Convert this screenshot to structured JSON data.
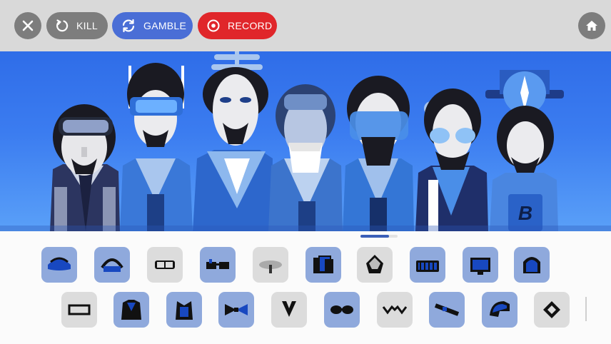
{
  "toolbar": {
    "kill_label": "KILL",
    "gamble_label": "GAMBLE",
    "record_label": "RECORD",
    "close_icon": "close-icon",
    "home_icon": "home-icon"
  },
  "colors": {
    "toolbar_bg": "#d9d9d9",
    "kill": "#7d7d7d",
    "gamble": "#4a6ed6",
    "record": "#e0262a",
    "stage_top": "#2f6de8",
    "stage_bottom": "#5aa0f8",
    "tile_active": "#8fa9dc",
    "tile_inactive": "#dcdcdc"
  },
  "characters": [
    {
      "name": "visor-character",
      "accessory": "goggles"
    },
    {
      "name": "antenna-character",
      "accessory": "blue-visor"
    },
    {
      "name": "hat-character",
      "accessory": "propeller-hat"
    },
    {
      "name": "masked-character",
      "accessory": "face-mask"
    },
    {
      "name": "shield-character",
      "accessory": "blue-shield-visor"
    },
    {
      "name": "sunglasses-character",
      "accessory": "round-sunglasses"
    },
    {
      "name": "tophat-character",
      "accessory": "compass-top-hat"
    }
  ],
  "sound_icons": {
    "row1": [
      {
        "icon": "cap-icon",
        "active": true
      },
      {
        "icon": "headband-icon",
        "active": true
      },
      {
        "icon": "goggles-icon",
        "active": false
      },
      {
        "icon": "glasses-icon",
        "active": true
      },
      {
        "icon": "disc-icon",
        "active": false
      },
      {
        "icon": "cards-icon",
        "active": true
      },
      {
        "icon": "skull-icon",
        "active": false
      },
      {
        "icon": "keyboard-icon",
        "active": true
      },
      {
        "icon": "monitor-icon",
        "active": true
      },
      {
        "icon": "hood-icon",
        "active": true
      }
    ],
    "row2": [
      {
        "icon": "frame-icon",
        "active": false
      },
      {
        "icon": "jacket-icon",
        "active": true
      },
      {
        "icon": "vest-icon",
        "active": true
      },
      {
        "icon": "bowtie-icon",
        "active": true
      },
      {
        "icon": "collar-icon",
        "active": false
      },
      {
        "icon": "shades-icon",
        "active": true
      },
      {
        "icon": "zigzag-glasses-icon",
        "active": false
      },
      {
        "icon": "tie-icon",
        "active": true
      },
      {
        "icon": "helmet-icon",
        "active": true
      },
      {
        "icon": "mask-icon",
        "active": false
      }
    ]
  }
}
